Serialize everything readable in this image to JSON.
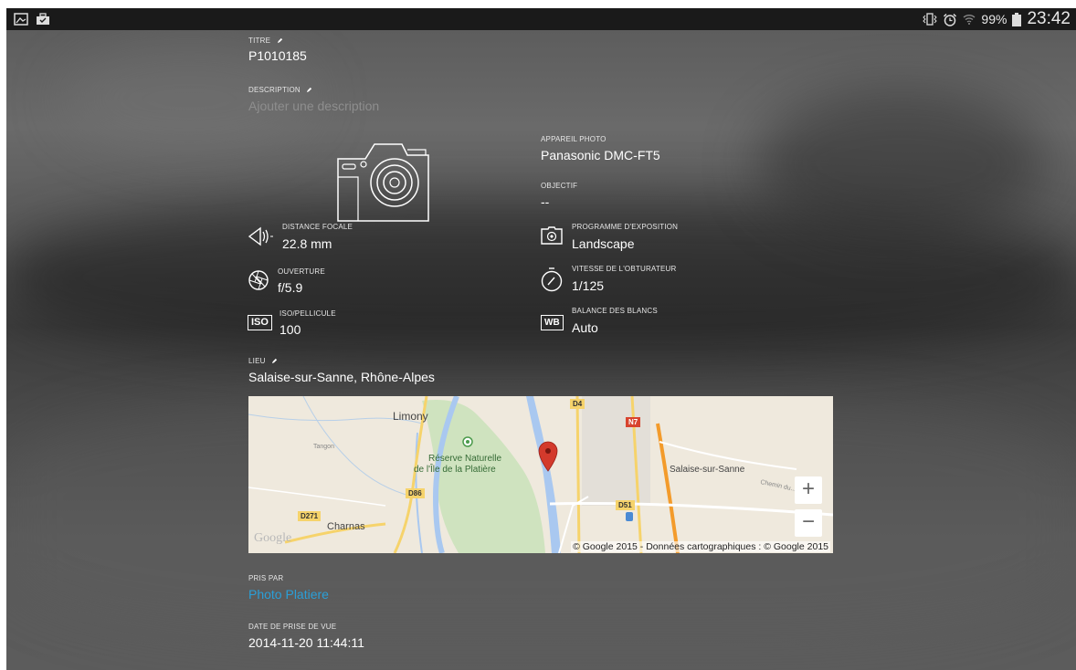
{
  "status_bar": {
    "left_icons": [
      "gallery-icon",
      "briefcase-icon"
    ],
    "right_icons": [
      "vibrate-icon",
      "alarm-icon",
      "wifi-icon",
      "battery-icon"
    ],
    "battery": "99%",
    "time": "23:42"
  },
  "title": {
    "label": "TITRE",
    "value": "P1010185"
  },
  "description": {
    "label": "DESCRIPTION",
    "placeholder": "Ajouter une description"
  },
  "camera": {
    "label": "APPAREIL PHOTO",
    "value": "Panasonic DMC-FT5",
    "lens_label": "OBJECTIF",
    "lens_value": "--"
  },
  "specs": {
    "focal": {
      "label": "DISTANCE FOCALE",
      "value": "22.8 mm"
    },
    "aperture": {
      "label": "OUVERTURE",
      "value": "f/5.9"
    },
    "iso": {
      "label": "ISO/PELLICULE",
      "value": "100",
      "badge": "ISO"
    },
    "exposure": {
      "label": "PROGRAMME D'EXPOSITION",
      "value": "Landscape"
    },
    "shutter": {
      "label": "VITESSE DE L'OBTURATEUR",
      "value": "1/125"
    },
    "wb": {
      "label": "BALANCE DES BLANCS",
      "value": "Auto",
      "badge": "WB"
    }
  },
  "location": {
    "label": "LIEU",
    "value": "Salaise-sur-Sanne, Rhône-Alpes"
  },
  "map": {
    "places": [
      "Limony",
      "Réserve Naturelle",
      "de l'Île de la Platière",
      "Salaise-sur-Sanne",
      "Charnas"
    ],
    "small_places": [
      "Tangon",
      "Chemin du..."
    ],
    "roads": [
      "D4",
      "N7",
      "D86",
      "D271",
      "D51"
    ],
    "zoom_in": "+",
    "zoom_out": "−",
    "brand": "Google",
    "copyright": "© Google 2015 - Données cartographiques : © Google 2015",
    "colors": {
      "water": "#a9c8f0",
      "park": "#cfe3bf",
      "land": "#efe9dd",
      "highway": "#f39b2b",
      "pin": "#d33a2c"
    }
  },
  "taken_by": {
    "label": "PRIS PAR",
    "value": "Photo Platiere"
  },
  "date": {
    "label": "DATE DE PRISE DE VUE",
    "value": "2014-11-20 11:44:11"
  },
  "colors": {
    "link": "#2a9fd8"
  }
}
